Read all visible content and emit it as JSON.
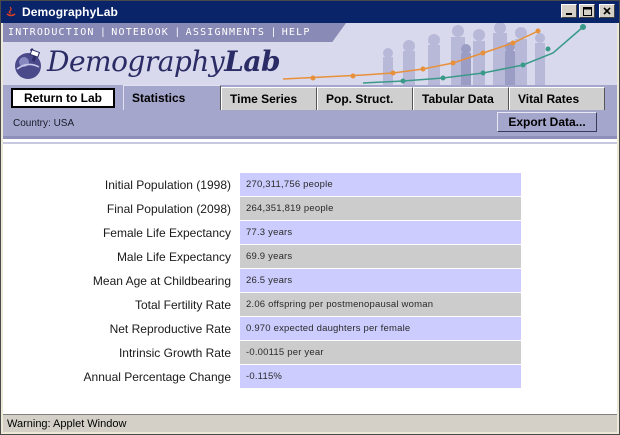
{
  "window": {
    "title": "DemographyLab"
  },
  "nav": {
    "items": [
      "INTRODUCTION",
      "NOTEBOOK",
      "ASSIGNMENTS",
      "HELP"
    ],
    "separator": "|"
  },
  "brand": {
    "light": "Demography",
    "bold": "Lab"
  },
  "tabs": {
    "return_label": "Return to Lab",
    "items": [
      "Statistics",
      "Time Series",
      "Pop. Struct.",
      "Tabular Data",
      "Vital Rates"
    ],
    "active": "Statistics"
  },
  "toolbar": {
    "country": "Country: USA",
    "export_label": "Export Data..."
  },
  "stats": [
    {
      "label": "Initial Population (1998)",
      "value": "270,311,756 people"
    },
    {
      "label": "Final Population (2098)",
      "value": "264,351,819 people"
    },
    {
      "label": "Female Life Expectancy",
      "value": "77.3 years"
    },
    {
      "label": "Male Life Expectancy",
      "value": "69.9 years"
    },
    {
      "label": "Mean Age at Childbearing",
      "value": "26.5 years"
    },
    {
      "label": "Total Fertility Rate",
      "value": "2.06 offspring per postmenopausal woman"
    },
    {
      "label": "Net Reproductive Rate",
      "value": "0.970 expected daughters per female"
    },
    {
      "label": "Intrinsic Growth Rate",
      "value": "-0.00115 per year"
    },
    {
      "label": "Annual Percentage Change",
      "value": "-0.115%"
    }
  ],
  "status": {
    "text": "Warning: Applet Window"
  },
  "colors": {
    "titlebar": "#0a246a",
    "accent": "#a4a6cc",
    "row_odd": "#ccccfe",
    "row_even": "#cccccc"
  }
}
